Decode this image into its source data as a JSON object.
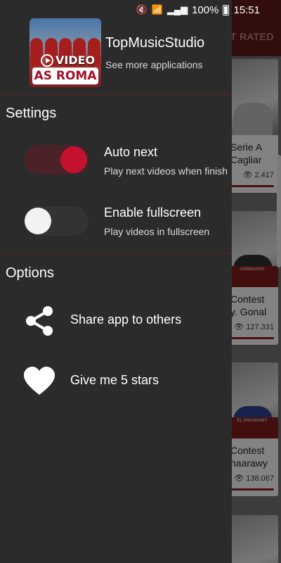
{
  "status_bar": {
    "battery": "100%",
    "time": "15:51"
  },
  "background": {
    "tab_label": "ST RATED",
    "cards": [
      {
        "title_line1": "Serie A",
        "title_line2": "Cagliar",
        "views": "2.417"
      },
      {
        "title_line1": "Contest",
        "title_line2": "y. Gonal",
        "views": "127.331",
        "badge": "GONALONS"
      },
      {
        "title_line1": "Contest",
        "title_line2": "haarawy",
        "views": "138.067",
        "badge": "EL SHAARAWY"
      }
    ]
  },
  "drawer": {
    "logo": {
      "video_text": "VIDEO",
      "team_text": "AS ROMA"
    },
    "studio_name": "TopMusicStudio",
    "studio_sub": "See more applications",
    "settings_title": "Settings",
    "settings": [
      {
        "title": "Auto next",
        "desc": "Play next videos when finish",
        "on": true
      },
      {
        "title": "Enable fullscreen",
        "desc": "Play videos in fullscreen",
        "on": false
      }
    ],
    "options_title": "Options",
    "options": [
      {
        "label": "Share app to others",
        "icon": "share-icon"
      },
      {
        "label": "Give me 5 stars",
        "icon": "heart-icon"
      }
    ]
  },
  "colors": {
    "accent": "#c4112f",
    "drawer_bg": "#2b2b2b",
    "divider": "#5b2226"
  }
}
